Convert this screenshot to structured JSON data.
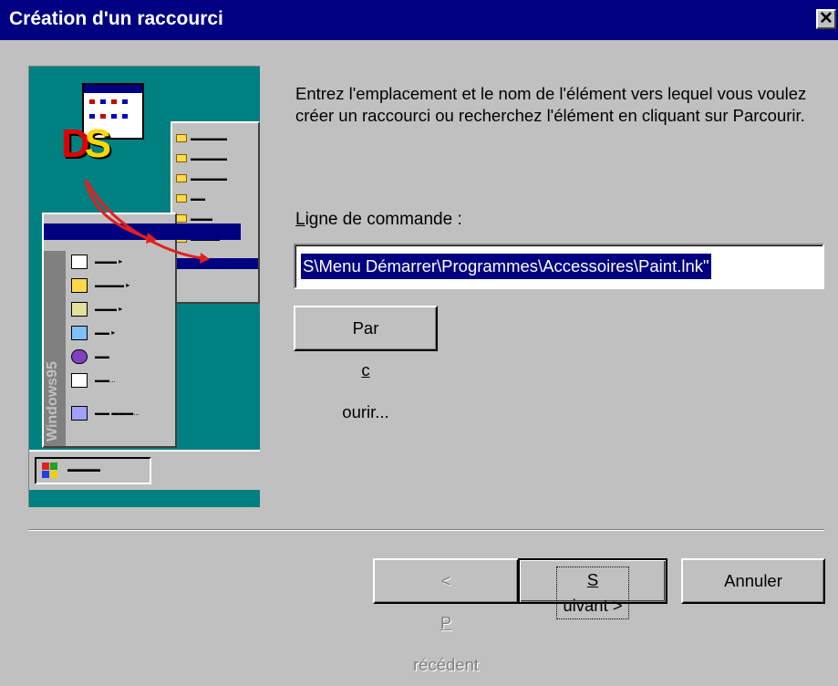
{
  "window": {
    "title": "Création d'un raccourci",
    "close_glyph": "✕"
  },
  "illustration": {
    "side_text": "Windows95"
  },
  "instruction": "Entrez l'emplacement et le nom de l'élément vers lequel vous voulez créer un raccourci ou recherchez l'élément en cliquant sur Parcourir.",
  "command_line": {
    "label_prefix": "",
    "label_mnemonic": "L",
    "label_rest": "igne de commande :",
    "value": "S\\Menu Démarrer\\Programmes\\Accessoires\\Paint.lnk\""
  },
  "buttons": {
    "browse_prefix": "Par",
    "browse_mnemonic": "c",
    "browse_rest": "ourir...",
    "prev_prefix": "< ",
    "prev_mnemonic": "P",
    "prev_rest": "récédent",
    "next_mnemonic": "S",
    "next_rest": "uivant >",
    "cancel": "Annuler"
  },
  "colors": {
    "title_bar": "#000080",
    "dialog_bg": "#c0c0c0",
    "illustration_bg": "#008080",
    "selection": "#000080"
  }
}
